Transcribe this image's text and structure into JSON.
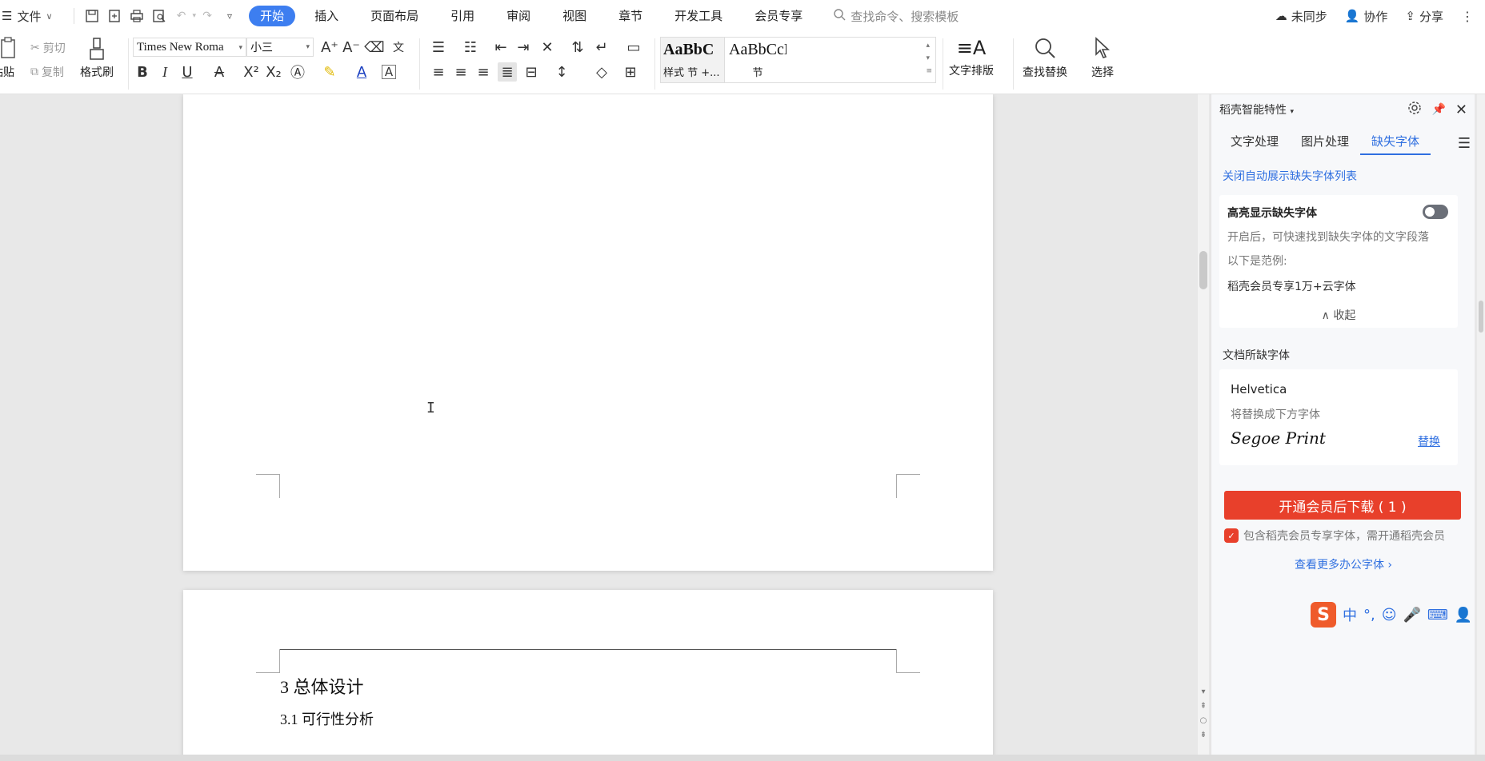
{
  "menubar": {
    "file_label": "文件",
    "tabs": [
      "开始",
      "插入",
      "页面布局",
      "引用",
      "审阅",
      "视图",
      "章节",
      "开发工具",
      "会员专享"
    ],
    "active_tab": "开始",
    "search_placeholder": "查找命令、搜索模板",
    "sync_label": "未同步",
    "collab_label": "协作",
    "share_label": "分享"
  },
  "ribbon": {
    "cut": "剪切",
    "copy": "复制",
    "paste": "粘贴",
    "format_painter": "格式刷",
    "font_name": "Times New Roma",
    "font_size": "小三",
    "style1_sample": "AaBbC",
    "style1_label": "样式 节 +...",
    "style2_sample": "AaBbCcD",
    "style2_label": "节",
    "text_layout": "文字排版",
    "find_replace": "查找替换",
    "select": "选择"
  },
  "document": {
    "heading": "3 总体设计",
    "subheading": "3.1  可行性分析"
  },
  "pane": {
    "title": "稻壳智能特性",
    "tabs": [
      "文字处理",
      "图片处理",
      "缺失字体"
    ],
    "active_tab": "缺失字体",
    "close_auto_link": "关闭自动展示缺失字体列表",
    "highlight_title": "高亮显示缺失字体",
    "highlight_desc": "开启后，可快速找到缺失字体的文字段落",
    "example_label": "以下是范例:",
    "example_text": "稻壳会员专享1万+云字体",
    "collapse": "收起",
    "missing_section": "文档所缺字体",
    "missing_font": "Helvetica",
    "replace_hint": "将替换成下方字体",
    "replacement_font": "Segoe Print",
    "replace_link": "替换",
    "cta": "开通会员后下载 ( 1 )",
    "note": "包含稻壳会员专享字体，需开通稻壳会员",
    "more_link": "查看更多办公字体"
  },
  "ime": {
    "mode": "中"
  }
}
